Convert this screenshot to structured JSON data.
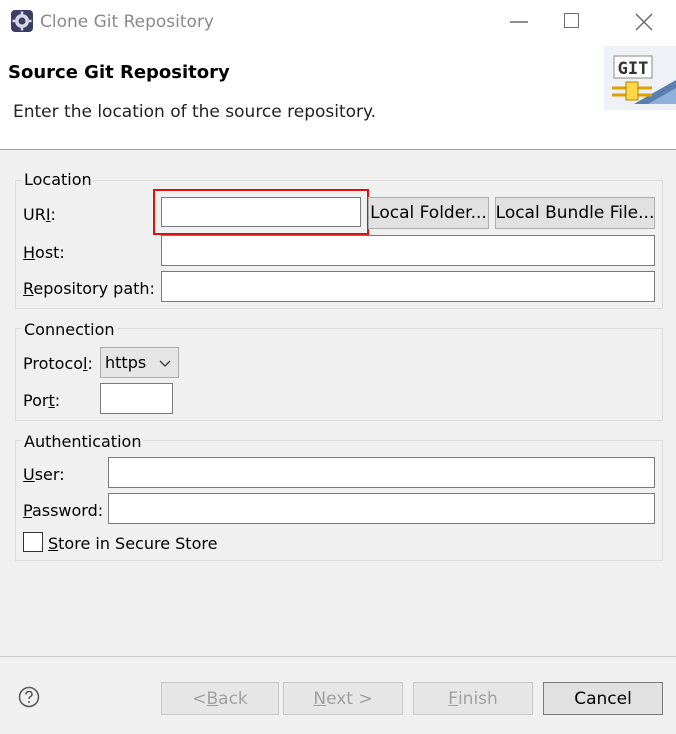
{
  "window": {
    "title": "Clone Git Repository",
    "icon": "eclipse-gear-icon"
  },
  "header": {
    "title": "Source Git Repository",
    "description": "Enter the location of the source repository.",
    "logo_text": "GIT"
  },
  "location": {
    "group_label": "Location",
    "uri_label_pre": "UR",
    "uri_label_mnemonic": "I",
    "uri_label_post": ":",
    "uri_value": "",
    "local_folder_button": "Local Folder...",
    "local_bundle_button": "Local Bundle File...",
    "host_label_mnemonic": "H",
    "host_label_post": "ost:",
    "host_value": "",
    "repo_path_label_mnemonic": "R",
    "repo_path_label_post": "epository path:",
    "repo_path_value": ""
  },
  "connection": {
    "group_label": "Connection",
    "protocol_label_pre": "Protoco",
    "protocol_label_mnemonic": "l",
    "protocol_label_post": ":",
    "protocol_value": "https",
    "port_label_pre": "Por",
    "port_label_mnemonic": "t",
    "port_label_post": ":",
    "port_value": ""
  },
  "authentication": {
    "group_label": "Authentication",
    "user_label_mnemonic": "U",
    "user_label_post": "ser:",
    "user_value": "",
    "password_label_mnemonic": "P",
    "password_label_post": "assword:",
    "password_value": "",
    "store_mnemonic": "S",
    "store_label_post": "tore in Secure Store",
    "store_checked": false
  },
  "footer": {
    "back_pre": "< ",
    "back_mnemonic": "B",
    "back_post": "ack",
    "next_mnemonic": "N",
    "next_post": "ext >",
    "finish_mnemonic": "F",
    "finish_post": "inish",
    "cancel": "Cancel"
  },
  "colors": {
    "highlight": "#e01010",
    "dialog_bg": "#f0f0f0"
  }
}
